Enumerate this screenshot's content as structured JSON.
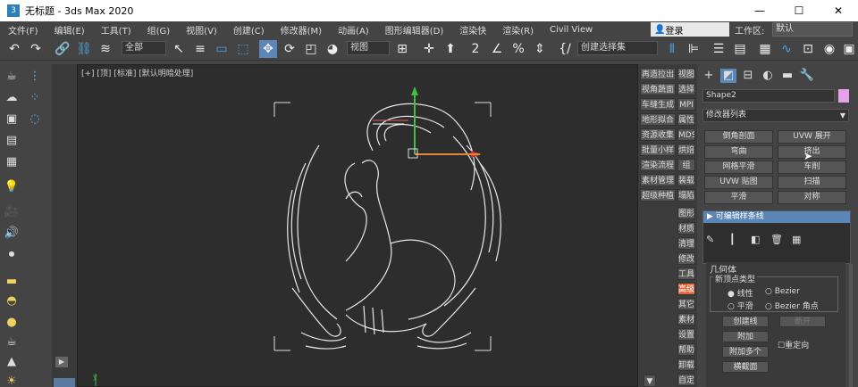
{
  "window": {
    "title": "无标题 - 3ds Max 2020",
    "minimize": "—",
    "maximize": "☐",
    "close": "✕"
  },
  "menu": {
    "items": [
      "文件(F)",
      "编辑(E)",
      "工具(T)",
      "组(G)",
      "视图(V)",
      "创建(C)",
      "修改器(M)",
      "动画(A)",
      "图形编辑器(D)",
      "渲染快",
      "渲染(R)",
      "Civil View"
    ],
    "login": "登录",
    "workspace_label": "工作区:",
    "workspace_value": "默认"
  },
  "toolbar": {
    "selection_filter": "全部",
    "ref_coord": "视图",
    "named_selection": "创建选择集"
  },
  "viewport": {
    "label": "[+] [顶] [标准] [默认明暗处理]"
  },
  "midpanel": {
    "col1": [
      "再造拉出",
      "视角蔬面",
      "车缝生成",
      "地形拟合",
      "资源收集",
      "批量小样",
      "渲染流程",
      "素材管理",
      "超级种植"
    ],
    "col2": [
      "视图",
      "选择",
      "MPI",
      "属性",
      "MDS",
      "烘焙",
      "组",
      "装载",
      "塌陷",
      "图形",
      "材质",
      "清理",
      "修改",
      "工具",
      "高级",
      "其它",
      "素材",
      "设置",
      "帮助",
      "卸载",
      "自定"
    ]
  },
  "cmdpanel": {
    "object_name": "Shape2",
    "modifier_list": "修改器列表",
    "modifier_buttons": [
      "倒角剖面",
      "UVW 展开",
      "弯曲",
      "挤出",
      "网格平滑",
      "车削",
      "UVW 贴图",
      "扫描",
      "平滑",
      "对称"
    ],
    "stack_item": "可编辑样条线",
    "rollout_title": "几何体",
    "group_label": "新顶点类型",
    "radio_linear": "线性",
    "radio_bezier": "Bezier",
    "radio_smooth": "平滑",
    "radio_bezier_corner": "Bezier 角点",
    "btn_create_line": "创建线",
    "btn_break": "断开",
    "btn_attach": "附加",
    "btn_attach_multi": "附加多个",
    "btn_cross_section": "横截面",
    "chk_reorient": "重定向"
  },
  "colors": {
    "accent": "#5a86b8",
    "viewport_bg": "#2d2d2d",
    "swatch": "#e8a0e8"
  }
}
